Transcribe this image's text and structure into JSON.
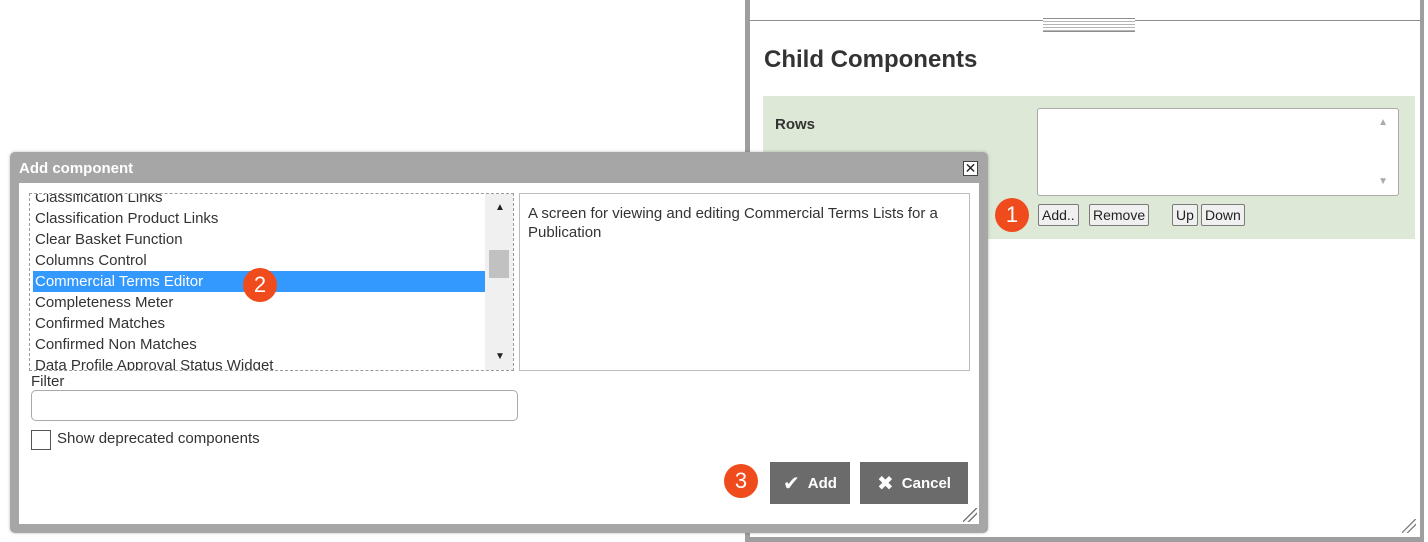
{
  "background_panel": {
    "title": "Child Components",
    "rows_label": "Rows",
    "buttons": {
      "add": "Add..",
      "remove": "Remove",
      "up": "Up",
      "down": "Down"
    },
    "scroll_up_glyph": "▲",
    "scroll_down_glyph": "▼"
  },
  "callouts": {
    "one": "1",
    "two": "2",
    "three": "3"
  },
  "dialog": {
    "title": "Add component",
    "close_glyph": "✕",
    "components": [
      "Classification Links",
      "Classification Product Links",
      "Clear Basket Function",
      "Columns Control",
      "Commercial Terms Editor",
      "Completeness Meter",
      "Confirmed Matches",
      "Confirmed Non Matches",
      "Data Profile Approval Status Widget"
    ],
    "selected_component": "Commercial Terms Editor",
    "description": "A screen for viewing and editing Commercial Terms Lists for a Publication",
    "filter_label": "Filter",
    "filter_value": "",
    "show_deprecated_label": "Show deprecated components",
    "show_deprecated_checked": false,
    "add_button": {
      "label": "Add",
      "icon": "✔"
    },
    "cancel_button": {
      "label": "Cancel",
      "icon": "✖"
    },
    "scroll_up_glyph": "▲",
    "scroll_down_glyph": "▼"
  },
  "colors": {
    "selection": "#3399ff",
    "callout": "#ef4b1c",
    "rows_background": "#dde9d6",
    "dialog_frame": "#a6a6a6",
    "action_button": "#6b6b6b"
  },
  "icons": [
    "close-icon",
    "check-icon",
    "x-icon",
    "scroll-up-icon",
    "scroll-down-icon",
    "resize-grip-icon"
  ]
}
